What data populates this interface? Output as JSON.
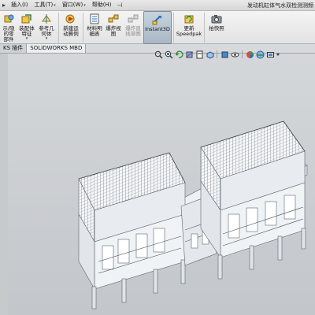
{
  "menubar": {
    "items": [
      {
        "label": "插入(I)",
        "has_dropdown": false
      },
      {
        "label": "工具(T)",
        "has_dropdown": true
      },
      {
        "label": "窗口(W)",
        "has_dropdown": true
      },
      {
        "label": "帮助(H)",
        "has_dropdown": false
      }
    ],
    "window_title": "发动机缸体气水双检测测频"
  },
  "ribbon": {
    "buttons": [
      {
        "label": "示/隐\n的零\n部件",
        "icon": "show-hidden-components-icon"
      },
      {
        "label": "装配体\n特征",
        "icon": "assembly-features-icon"
      },
      {
        "label": "参考几\n何体",
        "icon": "reference-geometry-icon"
      },
      {
        "label": "新建运\n动算例",
        "icon": "new-motion-study-icon"
      },
      {
        "label": "材料明\n细表",
        "icon": "bill-of-materials-icon"
      },
      {
        "label": "爆炸视\n图",
        "icon": "exploded-view-icon"
      },
      {
        "label": "爆炸直\n线草图",
        "icon": "explode-line-sketch-icon"
      },
      {
        "label": "Instant3D",
        "icon": "instant3d-icon"
      },
      {
        "label": "更新\nSpeedpak",
        "icon": "update-speedpak-icon"
      },
      {
        "label": "拍快照",
        "icon": "take-snapshot-icon"
      }
    ]
  },
  "tabs": [
    {
      "label": "KS 插件",
      "active": false
    },
    {
      "label": "SOLIDWORKS MBD",
      "active": true
    }
  ],
  "hud": {
    "tools": [
      "zoom-to-fit-icon",
      "zoom-to-area-icon",
      "previous-view-icon",
      "section-view-icon",
      "dynamic-annotation-icon",
      "view-orientation-icon",
      "display-style-icon",
      "hide-show-items-icon",
      "edit-appearance-icon",
      "apply-scene-icon",
      "view-settings-icon"
    ]
  },
  "colors": {
    "viewport_top": "#d4d7da",
    "viewport_bottom": "#c3c6ca",
    "model_fill": "#f4f6f8",
    "model_line": "#5e6670"
  }
}
